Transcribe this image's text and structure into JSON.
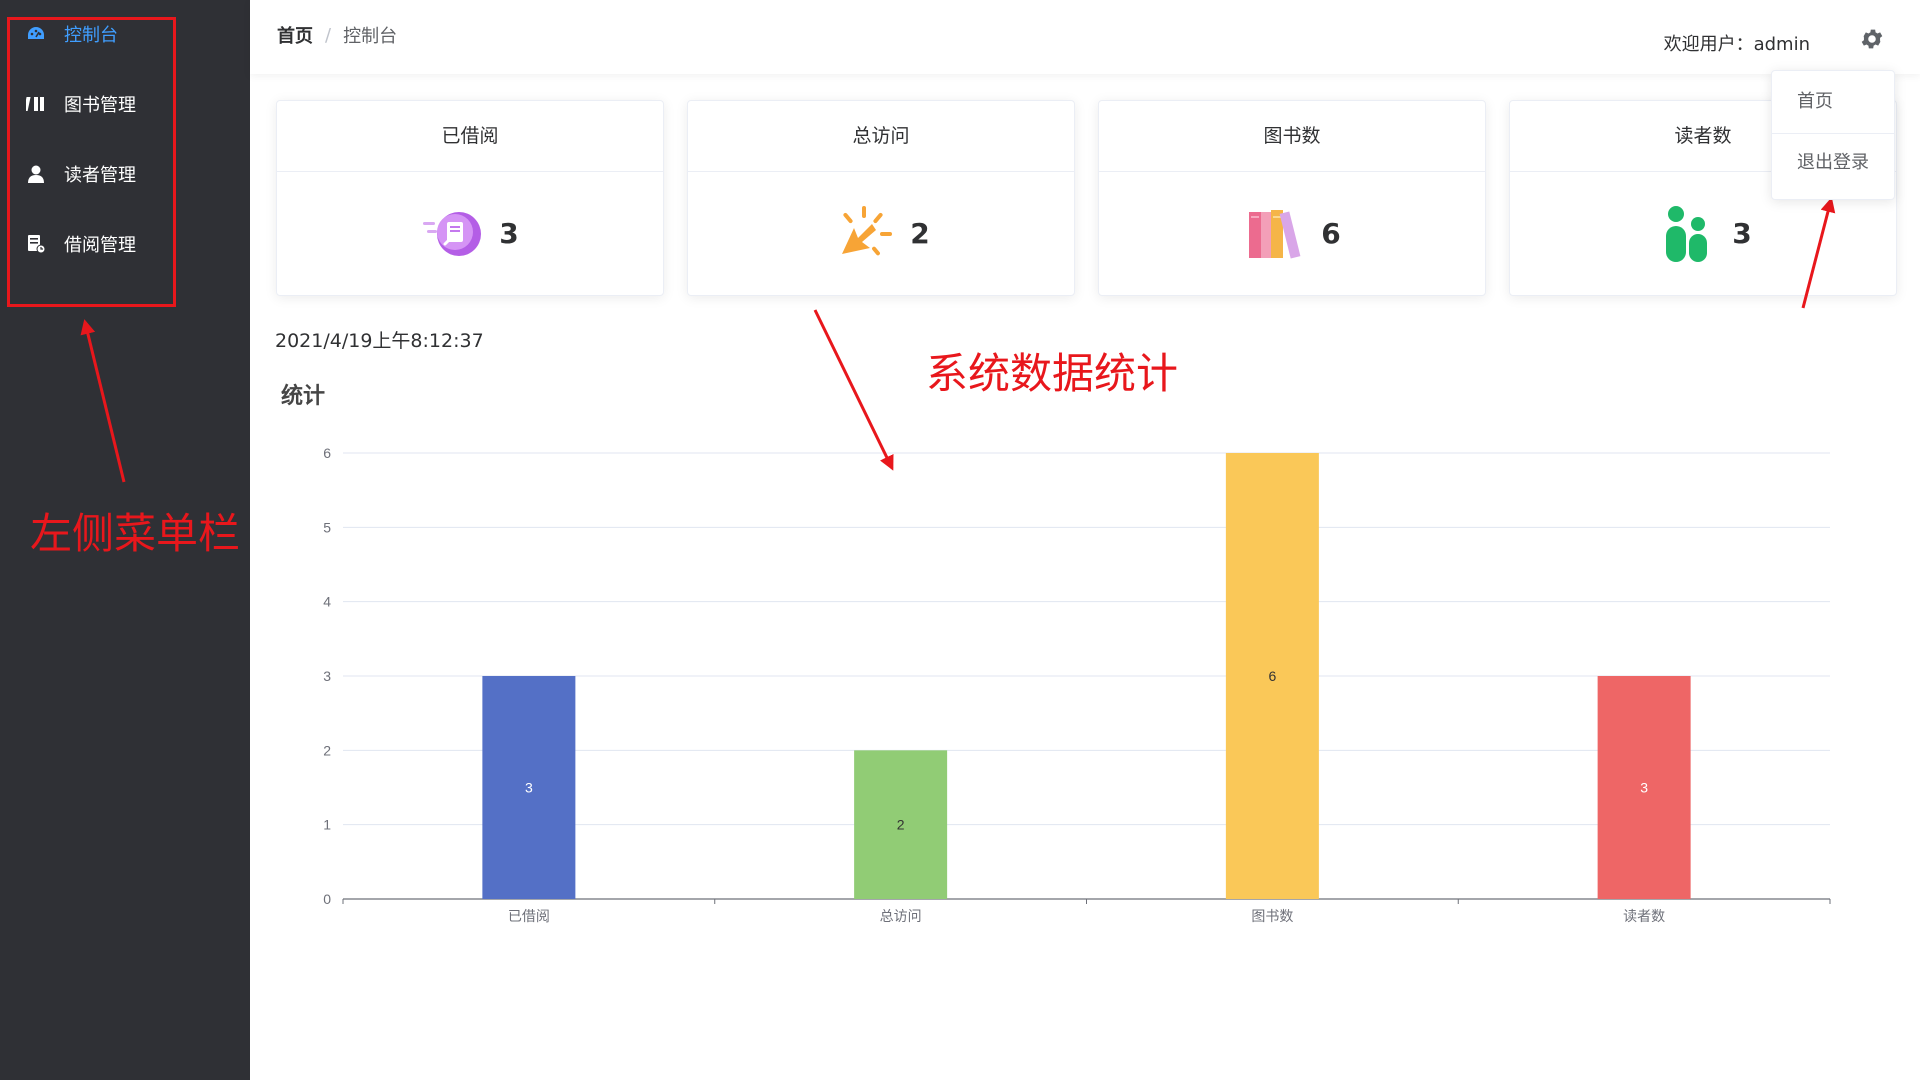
{
  "sidebar": {
    "items": [
      {
        "label": "控制台",
        "icon": "dashboard-icon",
        "active": true
      },
      {
        "label": "图书管理",
        "icon": "books-icon",
        "active": false
      },
      {
        "label": "读者管理",
        "icon": "user-icon",
        "active": false
      },
      {
        "label": "借阅管理",
        "icon": "borrow-record-icon",
        "active": false
      }
    ]
  },
  "header": {
    "breadcrumb_home": "首页",
    "breadcrumb_sep": "/",
    "breadcrumb_current": "控制台",
    "welcome": "欢迎用户：admin"
  },
  "dropdown": {
    "items": [
      "首页",
      "退出登录"
    ]
  },
  "cards": [
    {
      "title": "已借阅",
      "value": "3",
      "icon": "borrowed-icon"
    },
    {
      "title": "总访问",
      "value": "2",
      "icon": "visit-icon"
    },
    {
      "title": "图书数",
      "value": "6",
      "icon": "books-stack-icon"
    },
    {
      "title": "读者数",
      "value": "3",
      "icon": "readers-icon"
    }
  ],
  "timestamp": "2021/4/19上午8:12:37",
  "stat_title": "统计",
  "annotations": {
    "sidebar_note": "左侧菜单栏",
    "stats_note": "系统数据统计"
  },
  "colors": {
    "accent": "#409eff",
    "sidebar_bg": "#2f3035",
    "annotation": "#e8171c"
  },
  "chart_data": {
    "type": "bar",
    "categories": [
      "已借阅",
      "总访问",
      "图书数",
      "读者数"
    ],
    "values": [
      3,
      2,
      6,
      3
    ],
    "colors": [
      "#5470c6",
      "#91cc75",
      "#fac858",
      "#ee6666"
    ],
    "ylim": [
      0,
      6
    ],
    "yticks": [
      0,
      1,
      2,
      3,
      4,
      5,
      6
    ],
    "grid": true,
    "data_labels": true
  }
}
